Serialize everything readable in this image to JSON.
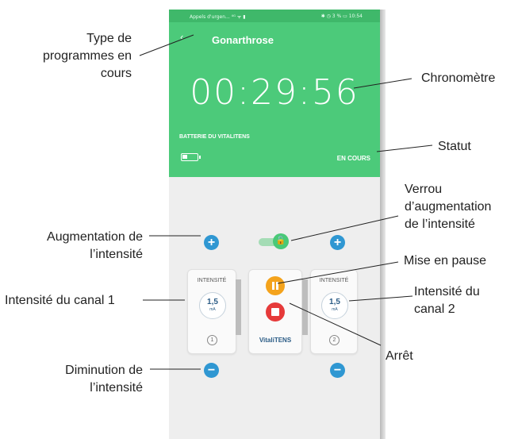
{
  "statusbar": {
    "left": "Appels d'urgen... ⁴ᴳ ᯤ ▮",
    "right": "✱ ◷ 3 % ▭ 10:54"
  },
  "header": {
    "title": "Gonarthrose",
    "timer": "00:29:56",
    "battery_label": "BATTERIE DU VITALITENS",
    "status": "EN COURS"
  },
  "channel1": {
    "label": "INTENSITÉ",
    "value": "1,5",
    "unit": "mA",
    "number": "1"
  },
  "channel2": {
    "label": "INTENSITÉ",
    "value": "1,5",
    "unit": "mA",
    "number": "2"
  },
  "center": {
    "brand": "VitaliTENS"
  },
  "icons": {
    "back": "arrow-left-icon",
    "plus": "plus-icon",
    "minus": "minus-icon",
    "lock": "lock-icon",
    "pause": "pause-icon",
    "stop": "stop-icon",
    "battery": "battery-icon"
  },
  "colors": {
    "header_green": "#4cca7a",
    "plus_blue": "#2f97d2",
    "pause_orange": "#f4a31c",
    "stop_red": "#e63a3a"
  },
  "annotations": {
    "type": [
      "Type de",
      "programmes en",
      "cours"
    ],
    "chrono": "Chronomètre",
    "statut": "Statut",
    "verrou": [
      "Verrou",
      "d’augmentation",
      "de l’intensité"
    ],
    "augmentation": [
      "Augmentation de",
      "l’intensité"
    ],
    "pause": "Mise en pause",
    "canal1": "Intensité du canal 1",
    "canal2": [
      "Intensité du",
      "canal 2"
    ],
    "arret": "Arrêt",
    "diminution": [
      "Diminution de",
      "l’intensité"
    ]
  }
}
